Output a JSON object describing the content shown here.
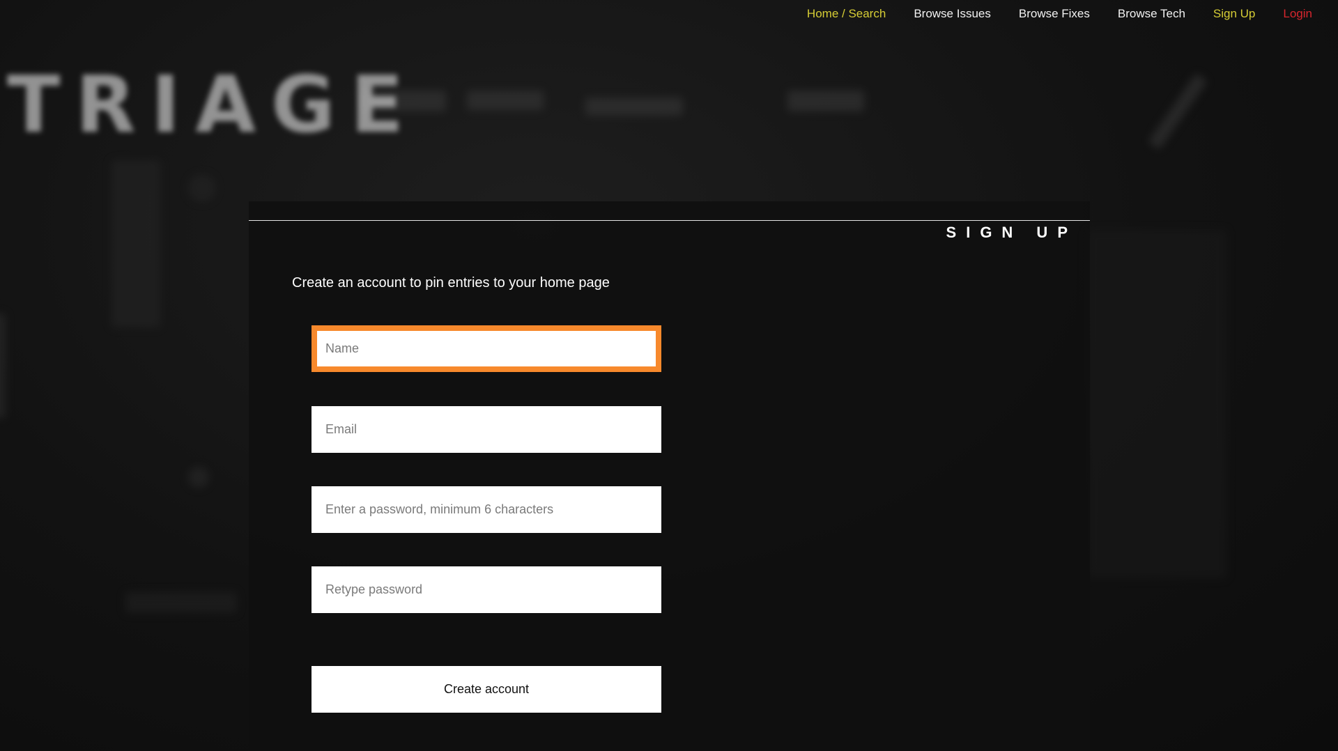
{
  "nav": {
    "home_label": "Home / Search",
    "issues_label": "Browse Issues",
    "fixes_label": "Browse Fixes",
    "tech_label": "Browse Tech",
    "signup_label": "Sign Up",
    "login_label": "Login"
  },
  "brand": {
    "logo_text": "TRIAGE"
  },
  "panel": {
    "title": "SIGN UP",
    "intro": "Create an account to pin entries to your home page"
  },
  "form": {
    "name_placeholder": "Name",
    "email_placeholder": "Email",
    "password_placeholder": "Enter a password, minimum 6 characters",
    "retype_placeholder": "Retype password",
    "submit_label": "Create account"
  },
  "colors": {
    "nav_accent": "#d6cd35",
    "login": "#d9262e",
    "focus_ring": "#f7892c"
  }
}
